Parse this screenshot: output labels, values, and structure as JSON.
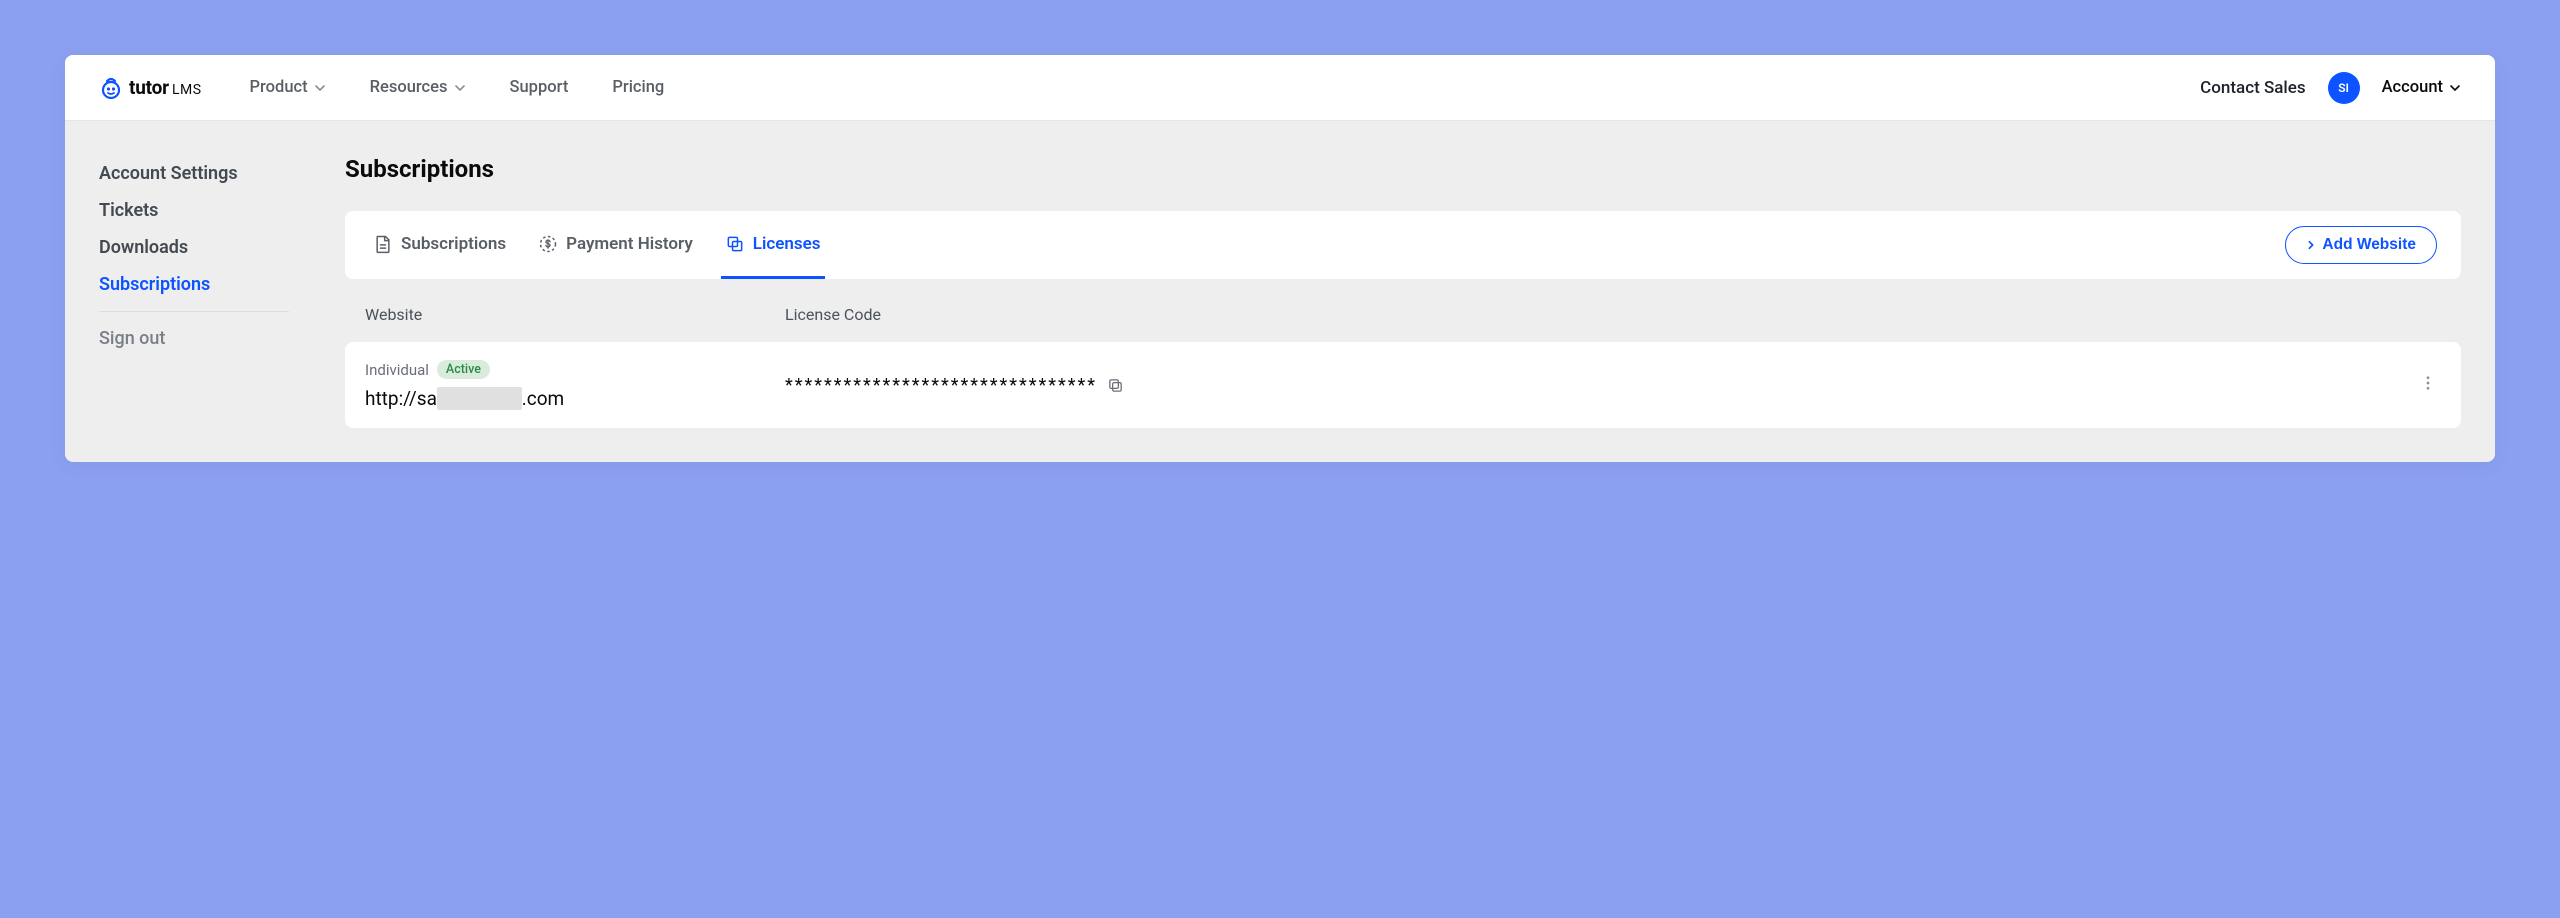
{
  "brand": {
    "name": "tutor",
    "suffix": "LMS"
  },
  "nav": {
    "product": "Product",
    "resources": "Resources",
    "support": "Support",
    "pricing": "Pricing",
    "contact_sales": "Contact Sales",
    "avatar_initials": "SI",
    "account": "Account"
  },
  "sidebar": {
    "items": [
      {
        "label": "Account Settings"
      },
      {
        "label": "Tickets"
      },
      {
        "label": "Downloads"
      },
      {
        "label": "Subscriptions"
      }
    ],
    "sign_out": "Sign out"
  },
  "page": {
    "title": "Subscriptions"
  },
  "tabs": {
    "subscriptions": "Subscriptions",
    "payment_history": "Payment History",
    "licenses": "Licenses"
  },
  "buttons": {
    "add_website": "Add Website"
  },
  "columns": {
    "website": "Website",
    "license": "License Code"
  },
  "license_row": {
    "plan": "Individual",
    "status": "Active",
    "url_prefix": "http://sa",
    "url_suffix": ".com",
    "code": "********************************"
  }
}
